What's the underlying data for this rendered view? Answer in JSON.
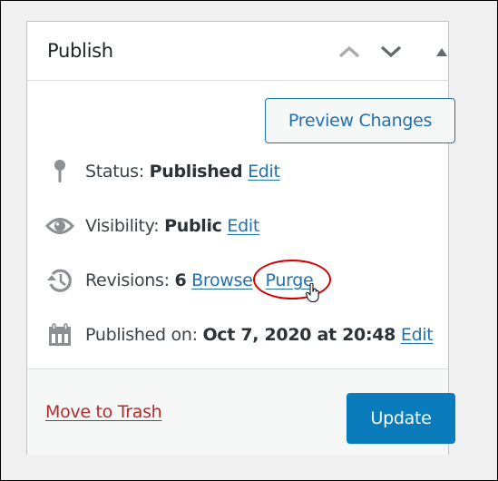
{
  "panel": {
    "title": "Publish",
    "header_icons": [
      "chevron-up-icon",
      "chevron-down-icon",
      "triangle-up-icon"
    ]
  },
  "preview_button": {
    "label": "Preview Changes"
  },
  "status": {
    "icon": "pin-icon",
    "label": "Status:",
    "value": "Published",
    "edit_label": "Edit"
  },
  "visibility": {
    "icon": "eye-icon",
    "label": "Visibility:",
    "value": "Public",
    "edit_label": "Edit"
  },
  "revisions": {
    "icon": "history-icon",
    "label": "Revisions:",
    "value": "6",
    "browse_label": "Browse",
    "purge_label": "Purge"
  },
  "published_on": {
    "icon": "calendar-icon",
    "label": "Published on:",
    "value": "Oct 7, 2020 at 20:48",
    "edit_label": "Edit"
  },
  "footer": {
    "trash_label": "Move to Trash",
    "update_label": "Update"
  },
  "colors": {
    "link": "#2271b1",
    "trash": "#b32d2e",
    "primary_button": "#0a7cbc",
    "annotation_circle": "#d40000",
    "icon_gray": "#787c82"
  }
}
